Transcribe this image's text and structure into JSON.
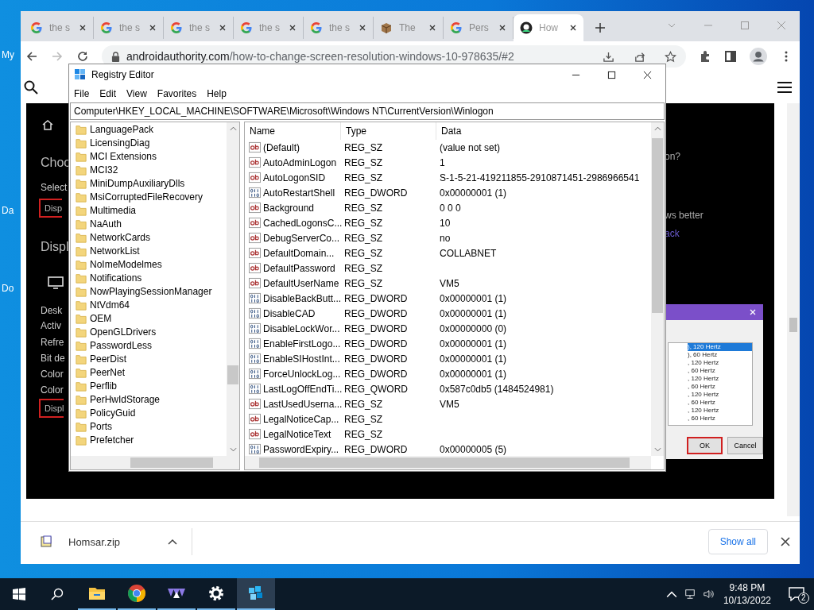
{
  "desktop_icons": [
    {
      "label": "My"
    },
    {
      "label": "Da"
    },
    {
      "label": "Do"
    }
  ],
  "browser": {
    "tabs": [
      {
        "title": "the s",
        "kind": "google",
        "selected": false
      },
      {
        "title": "the s",
        "kind": "google",
        "selected": false
      },
      {
        "title": "the s",
        "kind": "google",
        "selected": false
      },
      {
        "title": "the s",
        "kind": "google",
        "selected": false
      },
      {
        "title": "the s",
        "kind": "google",
        "selected": false
      },
      {
        "title": "The",
        "kind": "box",
        "selected": false
      },
      {
        "title": "Pers",
        "kind": "google",
        "selected": false
      },
      {
        "title": "How",
        "kind": "site",
        "selected": true
      }
    ],
    "address": {
      "domain": "androidauthority.com",
      "path": "/how-to-change-screen-resolution-windows-10-978635/#2"
    },
    "page": {
      "left_fragments": [
        {
          "text": "Choo",
          "kind": "heading"
        },
        {
          "text": "Select",
          "kind": "label"
        },
        {
          "text": "Disp",
          "kind": "outlined"
        },
        {
          "text": "Displ",
          "kind": "heading"
        },
        {
          "text": "Desk",
          "kind": "label"
        },
        {
          "text": "Activ",
          "kind": "label"
        },
        {
          "text": "Refre",
          "kind": "label"
        },
        {
          "text": "Bit de",
          "kind": "label"
        },
        {
          "text": "Color",
          "kind": "label"
        },
        {
          "text": "Color",
          "kind": "label"
        },
        {
          "text": "Displ",
          "kind": "outlined"
        }
      ],
      "right_fragments": [
        {
          "text": "on?",
          "kind": "label"
        },
        {
          "text": "ws better",
          "kind": "label"
        },
        {
          "text": "ack",
          "kind": "link"
        }
      ],
      "dialog": {
        "list": [
          {
            "text": "), 120 Hertz",
            "selected": true
          },
          {
            "text": "), 60 Hertz",
            "selected": false
          },
          {
            "text": ", 120 Hertz",
            "selected": false
          },
          {
            "text": ", 60 Hertz",
            "selected": false
          },
          {
            "text": ", 120 Hertz",
            "selected": false
          },
          {
            "text": ", 60 Hertz",
            "selected": false
          },
          {
            "text": ", 120 Hertz",
            "selected": false
          },
          {
            "text": ", 60 Hertz",
            "selected": false
          },
          {
            "text": ", 120 Hertz",
            "selected": false
          },
          {
            "text": ", 60 Hertz",
            "selected": false
          }
        ],
        "buttons": [
          {
            "label": "OK",
            "selected": true
          },
          {
            "label": "Cancel",
            "selected": false
          }
        ]
      }
    },
    "download": {
      "file": "Homsar.zip",
      "show_all": "Show all"
    }
  },
  "regedit": {
    "title": "Registry Editor",
    "menu": [
      "File",
      "Edit",
      "View",
      "Favorites",
      "Help"
    ],
    "address": "Computer\\HKEY_LOCAL_MACHINE\\SOFTWARE\\Microsoft\\Windows NT\\CurrentVersion\\Winlogon",
    "tree": [
      "LanguagePack",
      "LicensingDiag",
      "MCI Extensions",
      "MCI32",
      "MiniDumpAuxiliaryDlls",
      "MsiCorruptedFileRecovery",
      "Multimedia",
      "NaAuth",
      "NetworkCards",
      "NetworkList",
      "NoImeModelmes",
      "Notifications",
      "NowPlayingSessionManager",
      "NtVdm64",
      "OEM",
      "OpenGLDrivers",
      "PasswordLess",
      "PeerDist",
      "PeerNet",
      "Perflib",
      "PerHwIdStorage",
      "PolicyGuid",
      "Ports",
      "Prefetcher"
    ],
    "columns": [
      "Name",
      "Type",
      "Data"
    ],
    "values": [
      {
        "name": "(Default)",
        "type": "REG_SZ",
        "data": "(value not set)",
        "kind": "string"
      },
      {
        "name": "AutoAdminLogon",
        "type": "REG_SZ",
        "data": "1",
        "kind": "string"
      },
      {
        "name": "AutoLogonSID",
        "type": "REG_SZ",
        "data": "S-1-5-21-419211855-2910871451-2986966541",
        "kind": "string"
      },
      {
        "name": "AutoRestartShell",
        "type": "REG_DWORD",
        "data": "0x00000001 (1)",
        "kind": "binary"
      },
      {
        "name": "Background",
        "type": "REG_SZ",
        "data": "0 0 0",
        "kind": "string"
      },
      {
        "name": "CachedLogonsC...",
        "type": "REG_SZ",
        "data": "10",
        "kind": "string"
      },
      {
        "name": "DebugServerCo...",
        "type": "REG_SZ",
        "data": "no",
        "kind": "string"
      },
      {
        "name": "DefaultDomain...",
        "type": "REG_SZ",
        "data": "COLLABNET",
        "kind": "string"
      },
      {
        "name": "DefaultPassword",
        "type": "REG_SZ",
        "kind": "string"
      },
      {
        "name": "DefaultUserName",
        "type": "REG_SZ",
        "data": "VM5",
        "kind": "string"
      },
      {
        "name": "DisableBackButt...",
        "type": "REG_DWORD",
        "data": "0x00000001 (1)",
        "kind": "binary"
      },
      {
        "name": "DisableCAD",
        "type": "REG_DWORD",
        "data": "0x00000001 (1)",
        "kind": "binary"
      },
      {
        "name": "DisableLockWor...",
        "type": "REG_DWORD",
        "data": "0x00000000 (0)",
        "kind": "binary"
      },
      {
        "name": "EnableFirstLogo...",
        "type": "REG_DWORD",
        "data": "0x00000001 (1)",
        "kind": "binary"
      },
      {
        "name": "EnableSIHostInt...",
        "type": "REG_DWORD",
        "data": "0x00000001 (1)",
        "kind": "binary"
      },
      {
        "name": "ForceUnlockLog...",
        "type": "REG_DWORD",
        "data": "0x00000001 (1)",
        "kind": "binary"
      },
      {
        "name": "LastLogOffEndTi...",
        "type": "REG_QWORD",
        "data": "0x587c0db5 (1484524981)",
        "kind": "binary"
      },
      {
        "name": "LastUsedUserna...",
        "type": "REG_SZ",
        "data": "VM5",
        "kind": "string"
      },
      {
        "name": "LegalNoticeCap...",
        "type": "REG_SZ",
        "kind": "string"
      },
      {
        "name": "LegalNoticeText",
        "type": "REG_SZ",
        "kind": "string"
      },
      {
        "name": "PasswordExpiry...",
        "type": "REG_DWORD",
        "data": "0x00000005 (5)",
        "kind": "binary"
      }
    ]
  },
  "taskbar": {
    "apps": [
      {
        "kind": "explorer",
        "running": true,
        "selected": false
      },
      {
        "kind": "chrome",
        "running": true,
        "selected": false
      },
      {
        "kind": "triangles",
        "running": true,
        "selected": false
      },
      {
        "kind": "settings",
        "running": true,
        "selected": false
      },
      {
        "kind": "registry",
        "running": true,
        "selected": true
      }
    ],
    "time": "9:48 PM",
    "date": "10/13/2022",
    "notifications": "2"
  }
}
